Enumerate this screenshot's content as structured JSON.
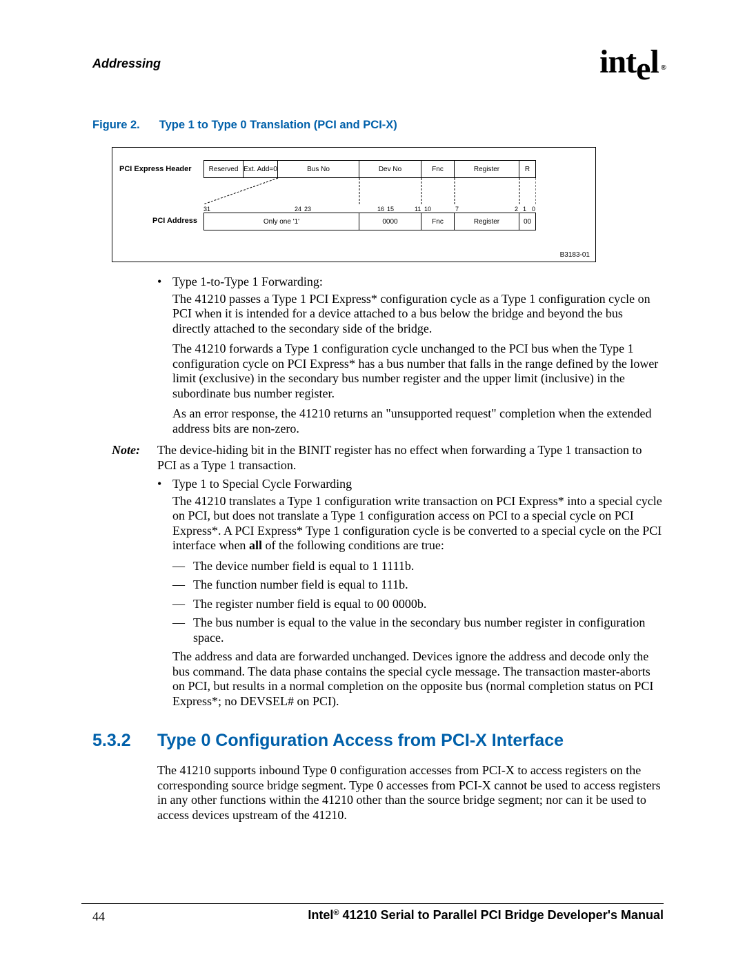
{
  "header": {
    "section": "Addressing",
    "logo_text": "int",
    "logo_e": "e",
    "logo_l": "l",
    "reg": "®"
  },
  "figure": {
    "caption_label": "Figure 2.",
    "caption_title": "Type 1 to Type 0 Translation (PCI and PCI-X)",
    "row1_label": "PCI Express Header",
    "row1": {
      "c0": "Reserved",
      "c1": "Ext. Add=0",
      "c2": "Bus No",
      "c3": "Dev No",
      "c4": "Fnc",
      "c5": "Register",
      "c6": "R"
    },
    "row2_label": "PCI Address",
    "row2": {
      "c0": "Only one '1'",
      "c1": "0000",
      "c2": "Fnc",
      "c3": "Register",
      "c4": "00"
    },
    "bits": {
      "b31": "31",
      "b24": "24",
      "b23": "23",
      "b16": "16",
      "b15": "15",
      "b11": "11",
      "b10": "10",
      "b7": "7",
      "b2": "2",
      "b1": "1",
      "b0": "0"
    },
    "ref": "B3183-01"
  },
  "content": {
    "b1_title": "Type 1-to-Type 1 Forwarding:",
    "b1_p1": "The 41210 passes a Type 1 PCI Express* configuration cycle as a Type 1 configuration cycle on PCI when it is intended for a device attached to a bus below the bridge and beyond the bus directly attached to the secondary side of the bridge.",
    "b1_p2": "The 41210 forwards a Type 1 configuration cycle unchanged to the PCI bus when the Type 1 configuration cycle on PCI Express* has a bus number that falls in the range defined by the lower limit (exclusive) in the secondary bus number register and the upper limit (inclusive) in the subordinate bus number register.",
    "b1_p3": "As an error response, the 41210 returns an \"unsupported request\" completion when the extended address bits are non-zero.",
    "note_label": "Note:",
    "note_text": "The device-hiding bit in the BINIT register has no effect when forwarding a Type 1 transaction to PCI as a Type 1 transaction.",
    "b2_title": "Type 1 to Special Cycle Forwarding",
    "b2_p1a": "The 41210 translates a Type 1 configuration write transaction on PCI Express* into a special cycle on PCI, but does not translate a Type 1 configuration access on PCI to a special cycle on PCI Express*. A PCI Express* Type 1 configuration cycle is be converted to a special cycle on the PCI interface when ",
    "b2_p1_all": "all",
    "b2_p1b": " of the following conditions are true:",
    "d1": "The device number field is equal to 1 1111b.",
    "d2": "The function number field is equal to 111b.",
    "d3": "The register number field is equal to 00 0000b.",
    "d4": "The bus number is equal to the value in the secondary bus number register in configuration space.",
    "b2_p2": "The address and data are forwarded unchanged. Devices ignore the address and decode only the bus command. The data phase contains the special cycle message. The transaction master-aborts on PCI, but results in a normal completion on the opposite bus (normal completion status on PCI Express*; no DEVSEL# on PCI)."
  },
  "section": {
    "num": "5.3.2",
    "title": "Type 0 Configuration Access from PCI-X Interface",
    "body": "The 41210 supports inbound Type 0 configuration accesses from PCI-X to access registers on the corresponding source bridge segment. Type 0 accesses from PCI-X cannot be used to access registers in any other functions within the 41210 other than the source bridge segment; nor can it be used to access devices upstream of the 41210."
  },
  "footer": {
    "page": "44",
    "title_a": "Intel",
    "title_reg": "®",
    "title_b": " 41210 Serial to Parallel PCI Bridge Developer's Manual"
  }
}
